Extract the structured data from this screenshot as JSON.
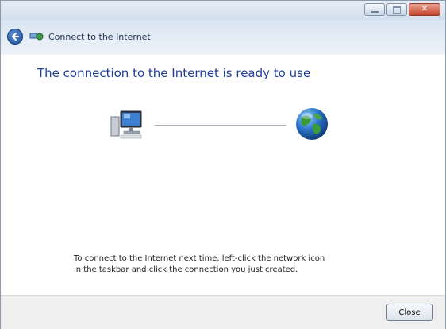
{
  "window": {
    "title": "Connect to the Internet",
    "caption_buttons": [
      "minimize-icon",
      "maximize-icon",
      "close-icon"
    ]
  },
  "nav": {
    "back_icon": "back-arrow-icon",
    "wizard_icon": "network-connection-icon"
  },
  "main": {
    "heading": "The connection to the Internet is ready to use",
    "left_icon": "computer-icon",
    "right_icon": "globe-icon",
    "instructions": "To connect to the Internet next time, left-click the network icon in the taskbar and click the connection you just created."
  },
  "footer": {
    "close_label": "Close"
  },
  "colors": {
    "heading": "#1e3f9a",
    "titlebar": "#d3dfed",
    "footer": "#f0f0f0",
    "close_caption": "#c7432a"
  }
}
